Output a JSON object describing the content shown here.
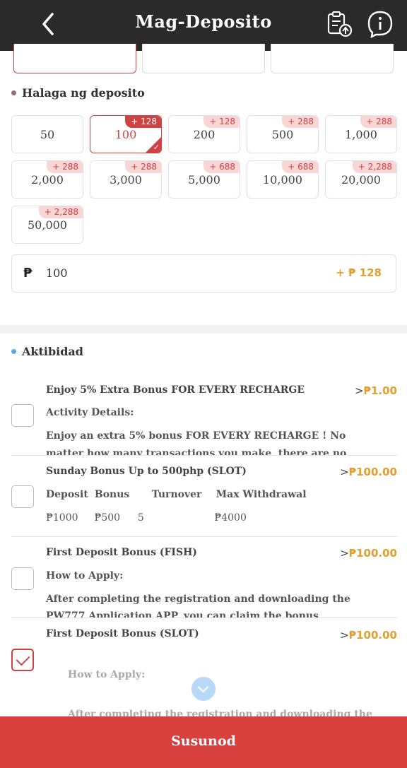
{
  "header": {
    "title": "Mag-Deposito",
    "back_icon": "back-chevron-icon",
    "records_icon": "clipboard-upload-icon",
    "info_icon": "info-icon"
  },
  "deposit": {
    "section_title": "Halaga ng deposito",
    "section_dot_color": "#9b6b6b",
    "amounts": [
      {
        "value": "50",
        "bonus": ""
      },
      {
        "value": "100",
        "bonus": "+ 128",
        "selected": true
      },
      {
        "value": "200",
        "bonus": "+ 128"
      },
      {
        "value": "500",
        "bonus": "+ 288"
      },
      {
        "value": "1,000",
        "bonus": "+ 288"
      },
      {
        "value": "2,000",
        "bonus": "+ 288"
      },
      {
        "value": "3,000",
        "bonus": "+ 288"
      },
      {
        "value": "5,000",
        "bonus": "+ 688"
      },
      {
        "value": "10,000",
        "bonus": "+ 688"
      },
      {
        "value": "20,000",
        "bonus": "+ 2,288"
      },
      {
        "value": "50,000",
        "bonus": "+ 2,288"
      }
    ],
    "input": {
      "currency": "₱",
      "value": "100",
      "bonus": "+ ₱ 128"
    }
  },
  "activities": {
    "section_title": "Aktibidad",
    "section_dot_color": "#5aaae0",
    "items": [
      {
        "name": "Enjoy 5% Extra Bonus FOR EVERY RECHARGE",
        "amount": "₱1.00",
        "line1": "Activity Details:",
        "line2": "Enjoy an extra 5% bonus FOR EVERY RECHARGE ! No",
        "line3": "matter how many transactions you make, there are no",
        "checked": false
      },
      {
        "name": "Sunday Bonus Up to 500php (SLOT)",
        "amount": "₱100.00",
        "cols_head": [
          "Deposit",
          "Bonus",
          "Turnover",
          "Max Withdrawal"
        ],
        "cols_vals": [
          "₱1000",
          "₱500",
          "5",
          "₱4000"
        ],
        "checked": false
      },
      {
        "name": "First Deposit Bonus (FISH)",
        "amount": "₱100.00",
        "line1": "How to Apply:",
        "line2": "After completing the registration and downloading the",
        "line3": "PW777 Application APP, you can claim the bonus",
        "checked": false
      },
      {
        "name": "First Deposit Bonus (SLOT)",
        "amount": "₱100.00",
        "line1": "How to Apply:",
        "line2": "After completing the registration and downloading the",
        "checked": true
      }
    ],
    "more_icon": "chevron-down-circle-icon"
  },
  "footer": {
    "button_label": "Susunod",
    "color": "#d8403d"
  }
}
